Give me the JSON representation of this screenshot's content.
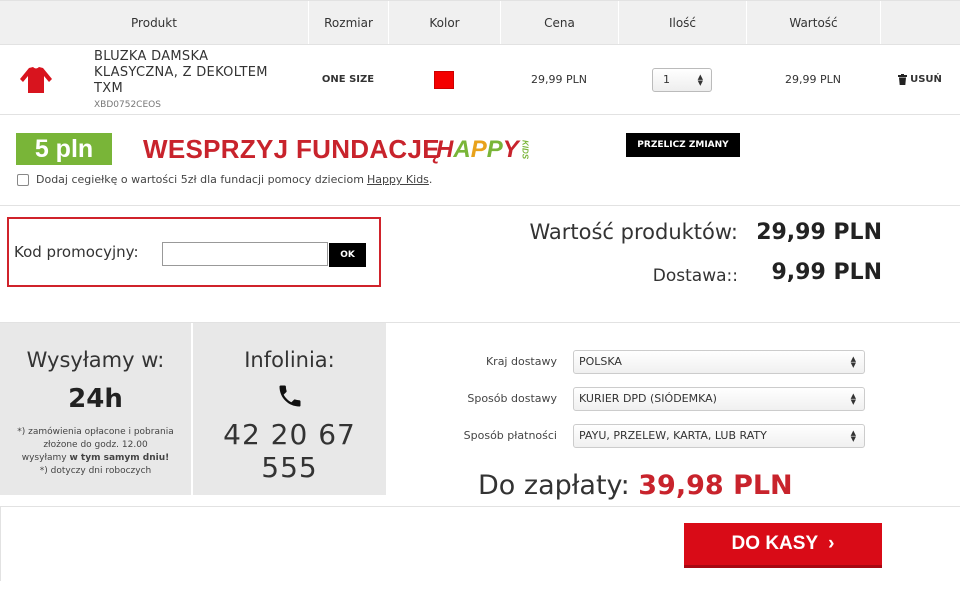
{
  "cart": {
    "headers": [
      "Produkt",
      "Rozmiar",
      "Kolor",
      "Cena",
      "Ilość",
      "Wartość"
    ],
    "item": {
      "name_line1": "BLUZKA DAMSKA",
      "name_line2": "KLASYCZNA, Z DEKOLTEM",
      "name_line3": "TXM",
      "sku": "XBD0752CEOS",
      "size": "ONE SIZE",
      "color_hex": "#f40000",
      "price": "29,99 PLN",
      "quantity": "1",
      "value": "29,99 PLN",
      "remove_label": "USUŃ"
    }
  },
  "donation": {
    "badge": "5 pln",
    "title": "WESPRZYJ FUNDACJĘ",
    "logo_letters": [
      "H",
      "A",
      "P",
      "P",
      "Y"
    ],
    "logo_sub": "KIDS",
    "recalc_label": "PRZELICZ ZMIANY",
    "checkbox_text": "Dodaj cegiełkę o wartości 5zł dla fundacji pomocy dzieciom",
    "checkbox_link": "Happy Kids",
    "checkbox_suffix": "."
  },
  "promo": {
    "label": "Kod promocyjny:",
    "input_value": "",
    "ok_label": "OK"
  },
  "totals": {
    "products_label": "Wartość produktów:",
    "products_value": "29,99 PLN",
    "delivery_label": "Dostawa::",
    "delivery_value": "9,99 PLN"
  },
  "shipping_info": {
    "title": "Wysyłamy w:",
    "hours": "24h",
    "note_line1": "*) zamówienia opłacone i pobrania",
    "note_line2": "złożone do godz. 12.00",
    "note_line3_pre": "wysyłamy ",
    "note_line3_bold": "w tym samym dniu!",
    "note_line4": "*) dotyczy dni roboczych"
  },
  "hotline": {
    "title": "Infolinia:",
    "icon": "phone-icon",
    "number": "42 20 67 555"
  },
  "selects": [
    {
      "label": "Kraj dostawy",
      "value": "POLSKA"
    },
    {
      "label": "Sposób dostawy",
      "value": "KURIER DPD (SIÓDEMKA)"
    },
    {
      "label": "Sposób płatności",
      "value": "PAYU, PRZELEW, KARTA, LUB RATY"
    }
  ],
  "payable": {
    "label": "Do zapłaty:",
    "amount": "39,98 PLN"
  },
  "checkout": {
    "label": "DO KASY",
    "arrow": "›"
  },
  "colors": {
    "accent_red": "#d90b17",
    "green": "#79b538",
    "promo_border": "#d0232b"
  }
}
